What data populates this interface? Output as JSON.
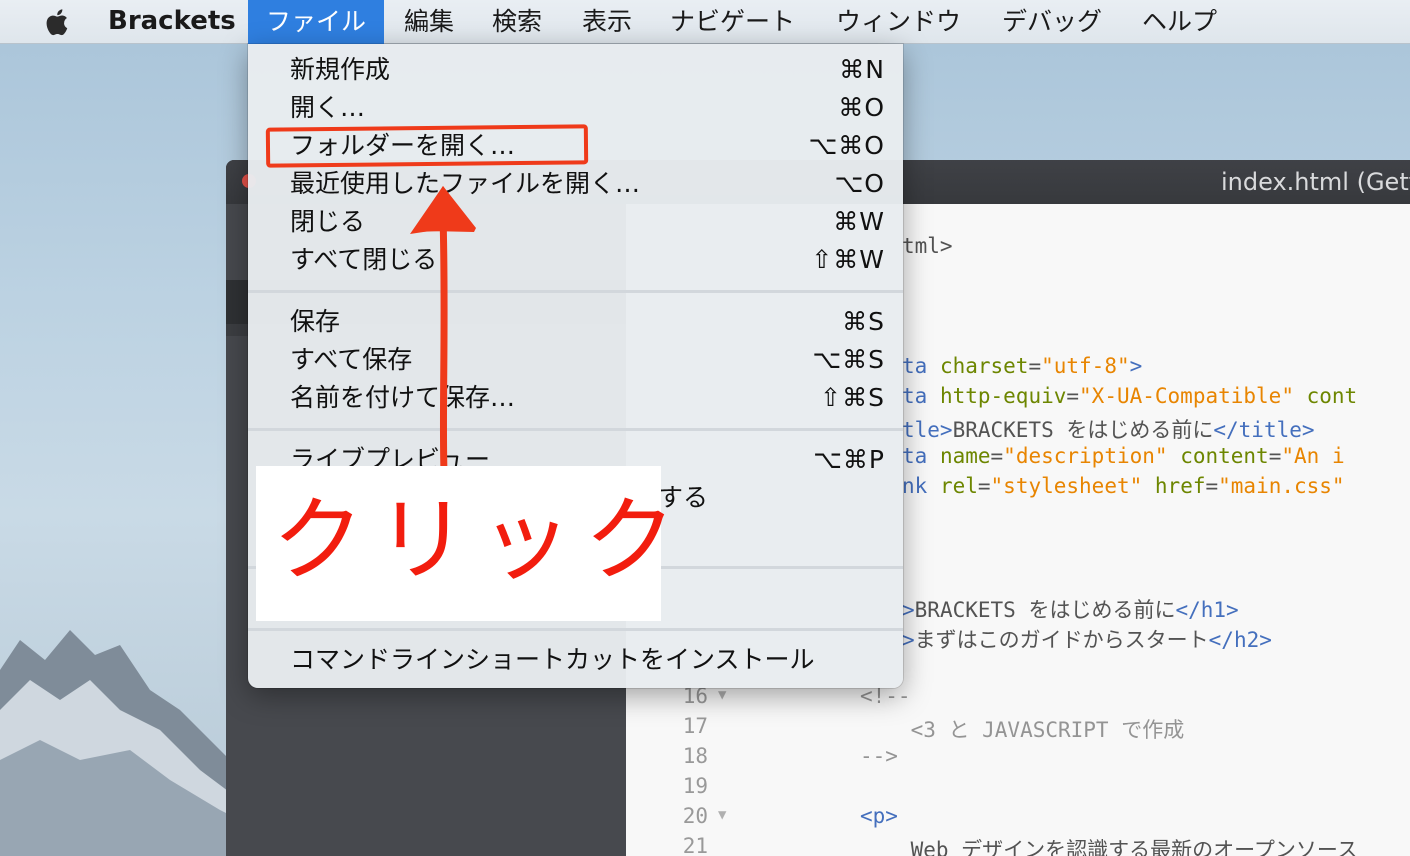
{
  "menubar": {
    "app_name": "Brackets",
    "items": [
      "ファイル",
      "編集",
      "検索",
      "表示",
      "ナビゲート",
      "ウィンドウ",
      "デバッグ",
      "ヘルプ"
    ],
    "active_index": 0
  },
  "file_menu": {
    "groups": [
      [
        {
          "label": "新規作成",
          "shortcut": "⌘N"
        },
        {
          "label": "開く…",
          "shortcut": "⌘O"
        },
        {
          "label": "フォルダーを開く…",
          "shortcut": "⌥⌘O"
        },
        {
          "label": "最近使用したファイルを開く…",
          "shortcut": "⌥O"
        },
        {
          "label": "閉じる",
          "shortcut": "⌘W"
        },
        {
          "label": "すべて閉じる",
          "shortcut": "⇧⌘W"
        }
      ],
      [
        {
          "label": "保存",
          "shortcut": "⌘S"
        },
        {
          "label": "すべて保存",
          "shortcut": "⌥⌘S"
        },
        {
          "label": "名前を付けて保存…",
          "shortcut": "⇧⌘S"
        }
      ],
      [
        {
          "label": "ライブプレビュー",
          "shortcut": "⌥⌘P"
        },
        {
          "label": "する",
          "shortcut": ""
        }
      ],
      [
        {
          "label": "コマンドラインショートカットをインストール",
          "shortcut": ""
        }
      ]
    ]
  },
  "annotation": {
    "click_text": "クリック",
    "color": "#f21d0e"
  },
  "editor": {
    "window_title": "index.html (Gett",
    "code_lines": [
      {
        "num": "",
        "parts": [
          [
            "txt",
            "tml>"
          ]
        ]
      },
      {
        "num": "",
        "parts": [
          [
            "tag",
            "ta "
          ],
          [
            "attr",
            "charset"
          ],
          [
            "txt",
            "="
          ],
          [
            "str",
            "\"utf-8\""
          ],
          [
            "tag",
            ">"
          ]
        ]
      },
      {
        "num": "",
        "parts": [
          [
            "tag",
            "ta "
          ],
          [
            "attr",
            "http-equiv"
          ],
          [
            "txt",
            "="
          ],
          [
            "str",
            "\"X-UA-Compatible\""
          ],
          [
            "txt",
            " "
          ],
          [
            "attr",
            "cont"
          ]
        ]
      },
      {
        "num": "",
        "parts": [
          [
            "tag",
            "tle>"
          ],
          [
            "txt",
            "BRACKETS をはじめる前に"
          ],
          [
            "tag",
            "</title>"
          ]
        ]
      },
      {
        "num": "",
        "parts": [
          [
            "tag",
            "ta "
          ],
          [
            "attr",
            "name"
          ],
          [
            "txt",
            "="
          ],
          [
            "str",
            "\"description\""
          ],
          [
            "txt",
            " "
          ],
          [
            "attr",
            "content"
          ],
          [
            "txt",
            "="
          ],
          [
            "str",
            "\"An i"
          ]
        ]
      },
      {
        "num": "",
        "parts": [
          [
            "tag",
            "nk "
          ],
          [
            "attr",
            "rel"
          ],
          [
            "txt",
            "="
          ],
          [
            "str",
            "\"stylesheet\""
          ],
          [
            "txt",
            " "
          ],
          [
            "attr",
            "href"
          ],
          [
            "txt",
            "="
          ],
          [
            "str",
            "\"main.css\""
          ]
        ]
      },
      {
        "num": "",
        "parts": [
          [
            "tag",
            ">"
          ],
          [
            "txt",
            "BRACKETS をはじめる前に"
          ],
          [
            "tag",
            "</h1>"
          ]
        ]
      },
      {
        "num": "",
        "parts": [
          [
            "tag",
            ">"
          ],
          [
            "txt",
            "まずはこのガイドからスタート"
          ],
          [
            "tag",
            "</h2>"
          ]
        ]
      },
      {
        "num": "16",
        "parts": [
          [
            "comment",
            "<!--"
          ]
        ]
      },
      {
        "num": "17",
        "parts": [
          [
            "comment",
            "    <3 と JAVASCRIPT で作成"
          ]
        ]
      },
      {
        "num": "18",
        "parts": [
          [
            "comment",
            "-->"
          ]
        ]
      },
      {
        "num": "19",
        "parts": []
      },
      {
        "num": "20",
        "parts": [
          [
            "tag",
            "<p>"
          ]
        ]
      },
      {
        "num": "21",
        "parts": [
          [
            "txt",
            "    Web デザインを認識する最新のオープンソース"
          ]
        ]
      }
    ]
  }
}
